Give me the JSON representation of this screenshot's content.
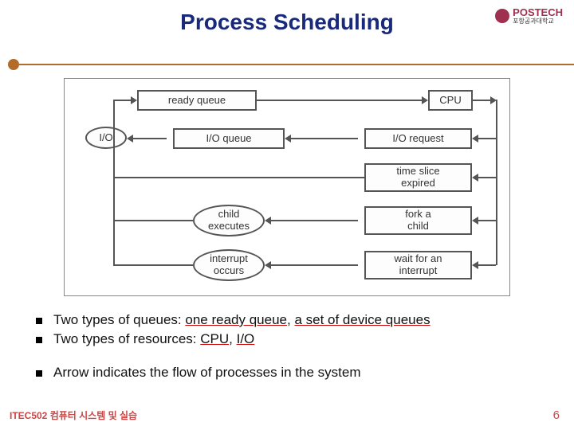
{
  "header": {
    "title": "Process Scheduling",
    "logo_text": "POSTECH",
    "logo_sub": "포항공과대학교"
  },
  "diagram": {
    "ready_queue": "ready queue",
    "cpu": "CPU",
    "io": "I/O",
    "io_queue": "I/O queue",
    "io_request": "I/O request",
    "time_slice": "time slice\nexpired",
    "child_exec": "child\nexecutes",
    "fork_child": "fork a\nchild",
    "interrupt_occurs": "interrupt\noccurs",
    "wait_interrupt": "wait for an\ninterrupt"
  },
  "bullets": {
    "b1_pre": "Two types of queues: ",
    "b1_u1": "one ready queue",
    "b1_mid": ", ",
    "b1_u2": "a set of device queues",
    "b2_pre": "Two types of resources: ",
    "b2_u1": "CPU",
    "b2_mid": ", ",
    "b2_u2": "I/O",
    "b3": "Arrow indicates the flow of processes in the system"
  },
  "footer": {
    "course": "ITEC502 컴퓨터 시스템 및 실습",
    "page": "6"
  }
}
